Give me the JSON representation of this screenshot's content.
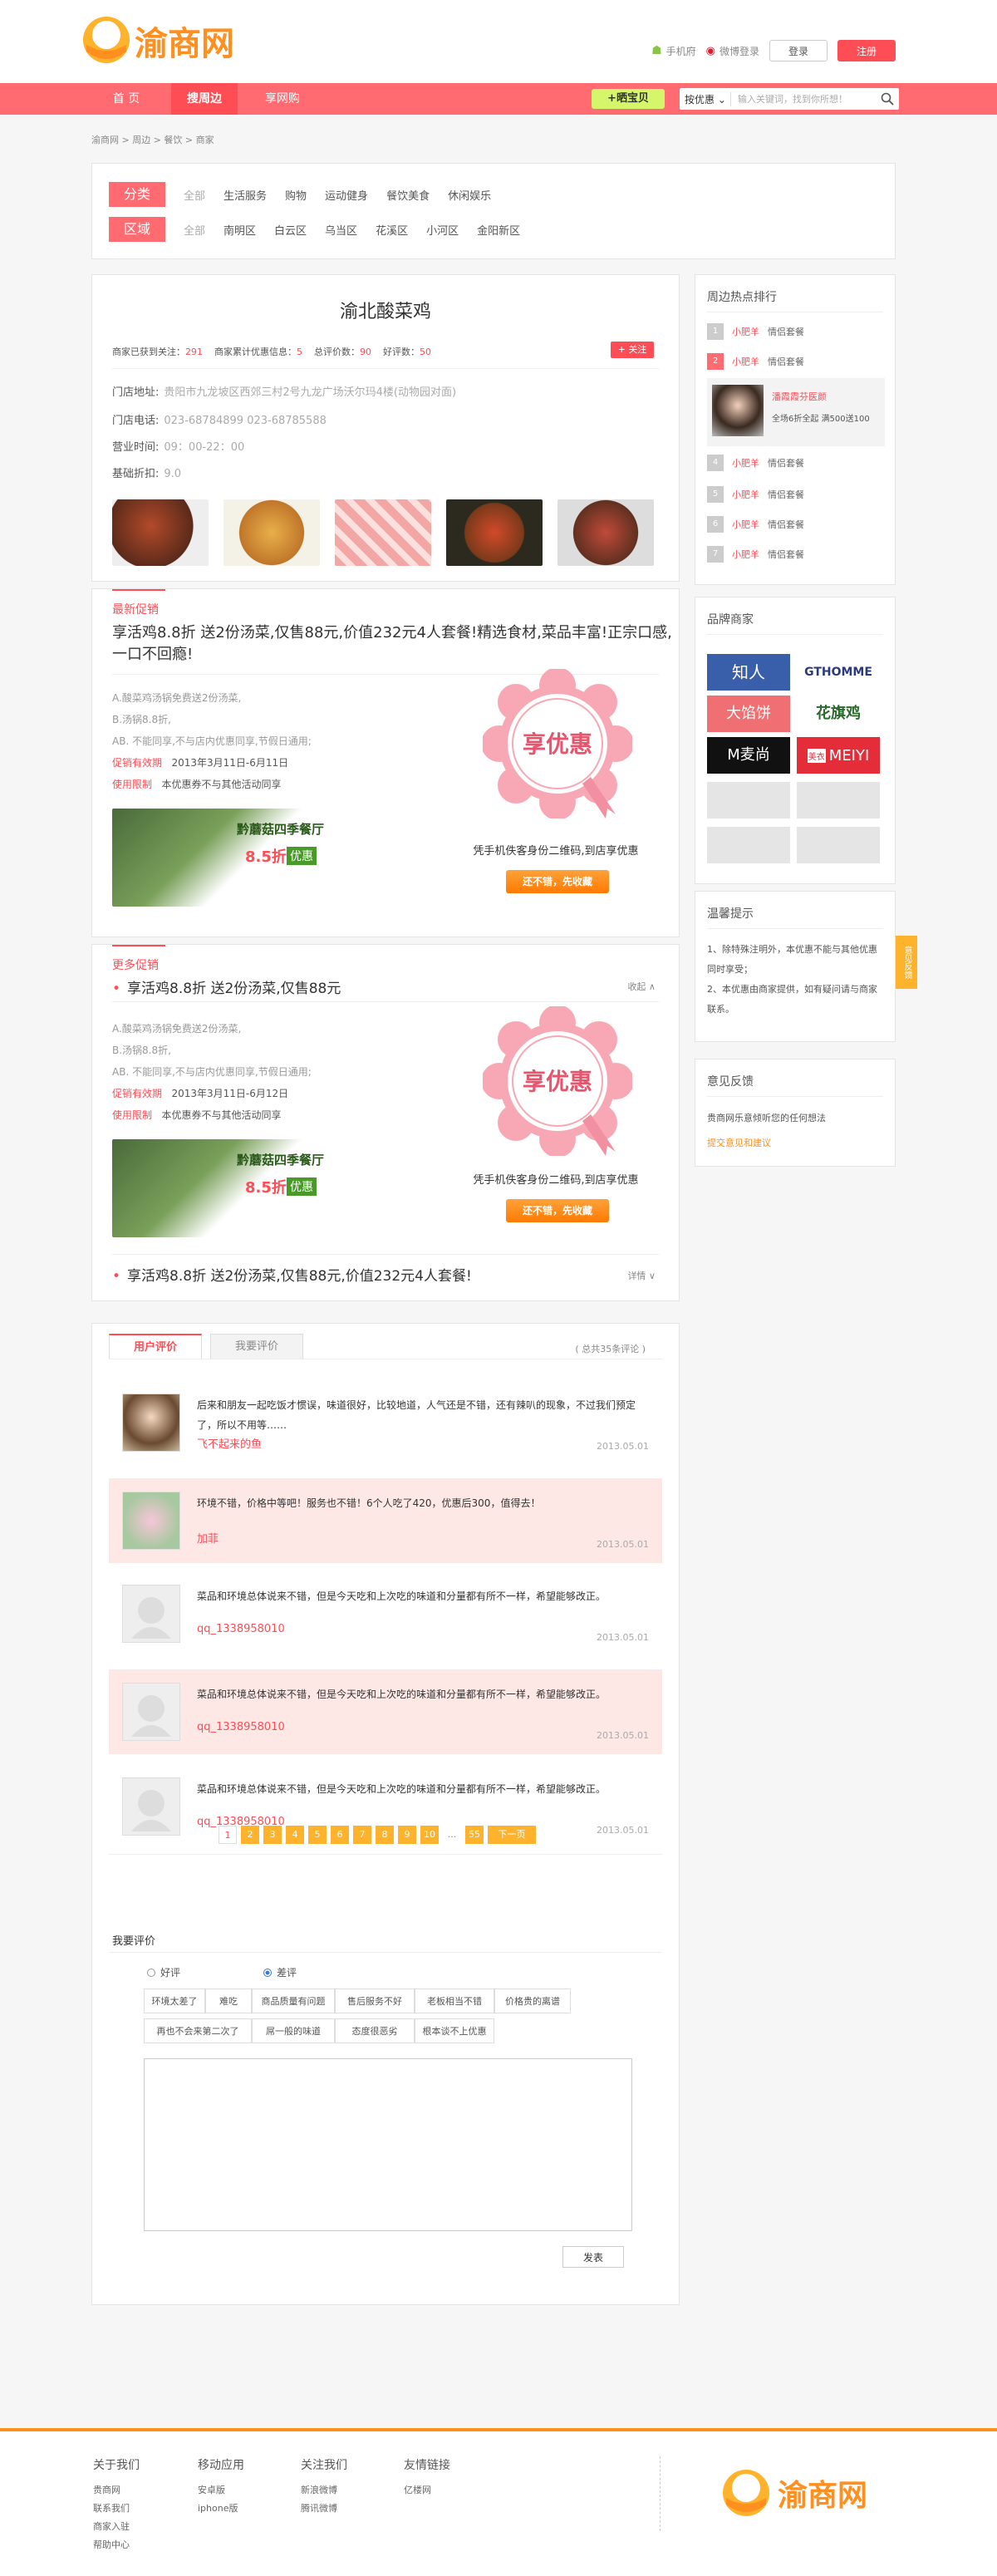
{
  "header": {
    "logo_text": "渝商网",
    "mobile": "手机府",
    "weibo": "微博登录",
    "login": "登录",
    "register": "注册"
  },
  "nav": {
    "items": [
      "首 页",
      "搜周边",
      "享网购"
    ],
    "sell": "+晒宝贝",
    "search_scope": "按优惠",
    "search_placeholder": "输入关键词，找到你所想！"
  },
  "breadcrumb": "渝商网 > 周边 > 餐饮 > 商家",
  "filter": {
    "category_label": "分类",
    "category_all": "全部",
    "categories": [
      "生活服务",
      "购物",
      "运动健身",
      "餐饮美食",
      "休闲娱乐"
    ],
    "district_label": "区域",
    "district_all": "全部",
    "districts": [
      "南明区",
      "白云区",
      "乌当区",
      "花溪区",
      "小河区",
      "金阳新区"
    ]
  },
  "shop": {
    "name": "渝北酸菜鸡",
    "stats": [
      [
        "商家已获到关注：",
        "291"
      ],
      [
        "商家累计优惠信息：",
        "5"
      ],
      [
        "总评价数：",
        "90"
      ],
      [
        "好评数：",
        "50"
      ]
    ],
    "follow": "+ 关注",
    "address_label": "门店地址:",
    "address": "贵阳市九龙坡区西郊三村2号九龙广场沃尔玛4楼(动物园对面)",
    "phone_label": "门店电话:",
    "phone": "023-68784899  023-68785588",
    "hours_label": "营业时间:",
    "hours": "09：00-22：00",
    "discount_label": "基础折扣:",
    "discount": "9.0"
  },
  "promo": {
    "latest_label": "最新促销",
    "title": "享活鸡8.8折 送2份汤菜,仅售88元,价值232元4人套餐!精选食材,菜品丰富!正宗口感,一口不回瘾!",
    "lines": [
      "A.酸菜鸡汤锅免费送2份汤菜,",
      "B.汤锅8.8折,",
      "AB. 不能同享,不与店内优惠同享,节假日通用;"
    ],
    "period_label": "促销有效期",
    "period": "2013年3月11日-6月11日",
    "limit_label": "使用限制",
    "limit": "本优惠券不与其他活动同享",
    "banner_title": "黔蘑菇四季餐厅",
    "banner_discount": "8.5折",
    "banner_tag": "优惠",
    "coupon_text": "享优惠",
    "coupon_caption": "凭手机佚客身份二维码,到店享优惠",
    "coupon_button": "还不错，先收藏"
  },
  "more": {
    "label": "更多促销",
    "item1": "享活鸡8.8折 送2份汤菜,仅售88元",
    "item1_action": "收起 ∧",
    "lines": [
      "A.酸菜鸡汤锅免费送2份汤菜,",
      "B.汤锅8.8折,",
      "AB. 不能同享,不与店内优惠同享,节假日通用;"
    ],
    "period_label": "促销有效期",
    "period": "2013年3月11日-6月12日",
    "limit_label": "使用限制",
    "limit": "本优惠券不与其他活动同享",
    "banner_title": "黔蘑菇四季餐厅",
    "banner_discount": "8.5折",
    "banner_tag": "优惠",
    "coupon_text": "享优惠",
    "coupon_caption": "凭手机佚客身份二维码,到店享优惠",
    "coupon_button": "还不错，先收藏",
    "item2": "享活鸡8.8折 送2份汤菜,仅售88元,价值232元4人套餐!",
    "item2_action": "详情 ∨"
  },
  "reviews": {
    "tab_user": "用户评价",
    "tab_mine": "我要评价",
    "total": "( 总共35条评论 )",
    "items": [
      {
        "text": "后来和朋友一起吃饭才惯误，味道很好，比较地道，人气还是不错，还有辣叭的现象，不过我们预定了，所以不用等……",
        "user": "飞不起来的鱼",
        "date": "2013.05.01"
      },
      {
        "text": "环境不错，价格中等吧！服务也不错！6个人吃了420，优惠后300，值得去！",
        "user": "加菲",
        "date": "2013.05.01"
      },
      {
        "text": "菜品和环境总体说来不错，但是今天吃和上次吃的味道和分量都有所不一样，希望能够改正。",
        "user": "qq_1338958010",
        "date": "2013.05.01"
      },
      {
        "text": "菜品和环境总体说来不错，但是今天吃和上次吃的味道和分量都有所不一样，希望能够改正。",
        "user": "qq_1338958010",
        "date": "2013.05.01"
      },
      {
        "text": "菜品和环境总体说来不错，但是今天吃和上次吃的味道和分量都有所不一样，希望能够改正。",
        "user": "qq_1338958010",
        "date": "2013.05.01"
      }
    ],
    "pages": [
      "1",
      "2",
      "3",
      "4",
      "5",
      "6",
      "7",
      "8",
      "9",
      "10"
    ],
    "ellipsis": "...",
    "last": "55",
    "next": "下一页"
  },
  "write": {
    "title": "我要评价",
    "good": "好评",
    "bad": "差评",
    "tags": [
      "环境太差了",
      "难吃",
      "商品质量有问题",
      "售后服务不好",
      "老板相当不错",
      "价格贵的离谱",
      "再也不会来第二次了",
      "屌一般的味道",
      "态度很恶劣",
      "根本谈不上优惠"
    ],
    "submit": "发表"
  },
  "side": {
    "hot_title": "周边热点排行",
    "hot": [
      {
        "num": "1",
        "name": "小肥羊",
        "desc": "情侣套餐"
      },
      {
        "num": "2",
        "name": "小肥羊",
        "desc": "情侣套餐"
      },
      {
        "num": "4",
        "name": "小肥羊",
        "desc": "情侣套餐"
      },
      {
        "num": "5",
        "name": "小肥羊",
        "desc": "情侣套餐"
      },
      {
        "num": "6",
        "name": "小肥羊",
        "desc": "情侣套餐"
      },
      {
        "num": "7",
        "name": "小肥羊",
        "desc": "情侣套餐"
      }
    ],
    "featured": {
      "name": "潘霞霞芬医颜",
      "desc": "全场6折全起",
      "extra": "满500送100"
    },
    "brand_title": "品牌商家",
    "brands": [
      "知人",
      "GTHOMME",
      "大馅饼",
      "花旗鸡",
      "M麦尚",
      "美衣",
      "MEIYI"
    ],
    "tips_title": "温馨提示",
    "tips": [
      "1、除特殊注明外，本优惠不能与其他优惠同时享受；",
      "2、本优惠由商家提供，如有疑问请与商家联系。"
    ],
    "feedback_title": "意见反馈",
    "feedback_text": "贵商网乐意倾听您的任何想法",
    "feedback_link": "提交意见和建议",
    "float": "意见反馈"
  },
  "footer": {
    "cols": [
      {
        "h": "关于我们",
        "l": [
          "贵商网",
          "联系我们",
          "商家入驻",
          "帮助中心"
        ]
      },
      {
        "h": "移动应用",
        "l": [
          "安卓版",
          "iphone版"
        ]
      },
      {
        "h": "关注我们",
        "l": [
          "新浪微博",
          "腾讯微博"
        ]
      },
      {
        "h": "友情链接",
        "l": [
          "亿楼网"
        ]
      }
    ],
    "logo_text": "渝商网"
  },
  "colors": {
    "accent": "#ff4d55",
    "nav": "#ff6b70",
    "orange": "#ff8f1f",
    "pink_row": "#fde8e6"
  }
}
